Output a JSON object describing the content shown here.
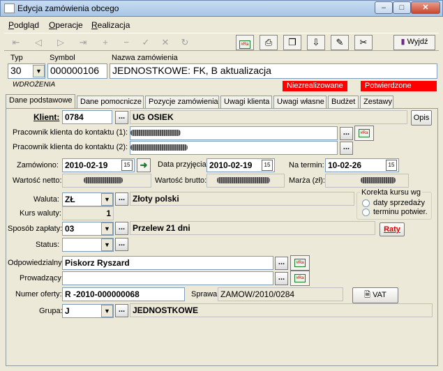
{
  "window": {
    "title": "Edycja zamówienia obcego",
    "minimize": "–",
    "maximize": "□",
    "close": "✕"
  },
  "menu": [
    {
      "accel": "P",
      "rest": "odgląd"
    },
    {
      "accel": "O",
      "rest": "peracje"
    },
    {
      "accel": "R",
      "rest": "ealizacja"
    }
  ],
  "toolbar": {
    "exit_label": "Wyjdź",
    "exit_accel": "y"
  },
  "header": {
    "typ_label": "Typ",
    "typ_value": "30",
    "symbol_label": "Symbol",
    "symbol_value": "000000106",
    "name_label": "Nazwa zamówienia",
    "name_value": "JEDNOSTKOWE: FK, B aktualizacja",
    "stage": "WDROŻENIA",
    "badge1": "Niezrealizowane",
    "badge2": "Potwierdzone"
  },
  "tabs": [
    "Dane podstawowe",
    "Dane pomocnicze",
    "Pozycje zamówienia",
    "Uwagi klienta",
    "Uwagi własne",
    "Budżet",
    "Zestawy"
  ],
  "form": {
    "klient_label": "Klient:",
    "klient_code": "0784",
    "klient_name": "UG OSIEK",
    "opis_label": "Opis",
    "kontakt1_label": "Pracownik klienta do kontaktu (1):",
    "kontakt2_label": "Pracownik klienta do kontaktu (2):",
    "zamowiono_label": "Zamówiono:",
    "zamowiono_value": "2010-02-19",
    "przyjecia_label": "Data przyjęcia:",
    "przyjecia_value": "2010-02-19",
    "termin_label": "Na termin:",
    "termin_value": "10-02-26",
    "netto_label": "Wartość netto:",
    "brutto_label": "Wartość brutto:",
    "marza_label": "Marża (zł):",
    "waluta_label": "Waluta:",
    "waluta_value": "ZŁ",
    "waluta_name": "Złoty polski",
    "kurs_label": "Kurs waluty:",
    "kurs_value": "1",
    "korekta_title": "Korekta kursu wg",
    "korekta_opt1": "daty sprzedaży",
    "korekta_opt2": "terminu potwier.",
    "platnosc_label": "Sposób zapłaty:",
    "platnosc_value": "03",
    "platnosc_name": "Przelew 21 dni",
    "raty_label": "Raty",
    "status_label": "Status:",
    "status_value": "",
    "odpowiedzialny_label": "Odpowiedzialny:",
    "odpowiedzialny_value": "Piskorz Ryszard",
    "prowadzacy_label": "Prowadzący:",
    "prowadzacy_value": "",
    "oferta_label": "Numer oferty:",
    "oferta_value": "R  -2010-000000068",
    "sprawa_label": "Sprawa:",
    "sprawa_value": "ZAMOW/2010/0284",
    "vat_label": "VAT",
    "grupa_label": "Grupa:",
    "grupa_value": "J",
    "grupa_name": "JEDNOSTKOWE"
  },
  "calendar_glyph": "15",
  "dots_glyph": "...",
  "dropdown_glyph": "▼",
  "grn_glyph": "#Ra"
}
